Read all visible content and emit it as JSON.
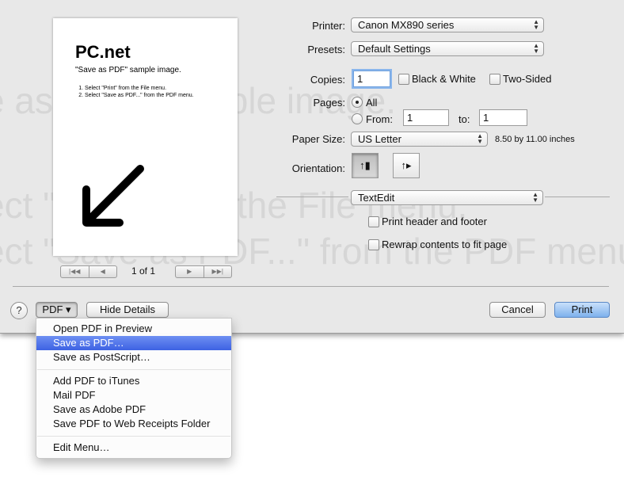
{
  "background_text": {
    "line1": "e as PDF\" sample image.",
    "line2": "ect \"Print\" from the File menu.",
    "line3": "ect \"Save as PDF...\" from the PDF menu."
  },
  "preview": {
    "title": "PC.net",
    "subtitle": "\"Save as PDF\" sample image.",
    "steps": [
      "Select \"Print\" from the File menu.",
      "Select \"Save as PDF...\" from the PDF menu."
    ],
    "arrow_icon": "arrow-down-left-icon",
    "page_indicator": "1 of 1",
    "nav_first": "|◀◀",
    "nav_prev": "◀",
    "nav_next": "▶",
    "nav_last": "▶▶|"
  },
  "settings": {
    "printer_label": "Printer:",
    "printer_value": "Canon MX890 series",
    "presets_label": "Presets:",
    "presets_value": "Default Settings",
    "copies_label": "Copies:",
    "copies_value": "1",
    "black_white_label": "Black & White",
    "two_sided_label": "Two-Sided",
    "pages_label": "Pages:",
    "pages_all_label": "All",
    "pages_from_label": "From:",
    "pages_from_value": "1",
    "pages_to_label": "to:",
    "pages_to_value": "1",
    "paper_size_label": "Paper Size:",
    "paper_size_value": "US Letter",
    "paper_dimensions": "8.50 by 11.00 inches",
    "orientation_label": "Orientation:",
    "orientation_selected": "portrait"
  },
  "app_section": {
    "popup_value": "TextEdit",
    "print_header_footer_label": "Print header and footer",
    "rewrap_label": "Rewrap contents to fit page"
  },
  "bottom_bar": {
    "help_label": "?",
    "pdf_button_label": "PDF ▾",
    "hide_details_label": "Hide Details",
    "cancel_label": "Cancel",
    "print_label": "Print"
  },
  "pdf_menu": {
    "items": [
      "Open PDF in Preview",
      "Save as PDF…",
      "Save as PostScript…",
      "Add PDF to iTunes",
      "Mail PDF",
      "Save as Adobe PDF",
      "Save PDF to Web Receipts Folder",
      "Edit Menu…"
    ],
    "highlighted_index": 1
  },
  "colors": {
    "accent": "#3d62e3",
    "default_button": "#7eb1ec",
    "sheet_background": "#e8e8e8"
  }
}
